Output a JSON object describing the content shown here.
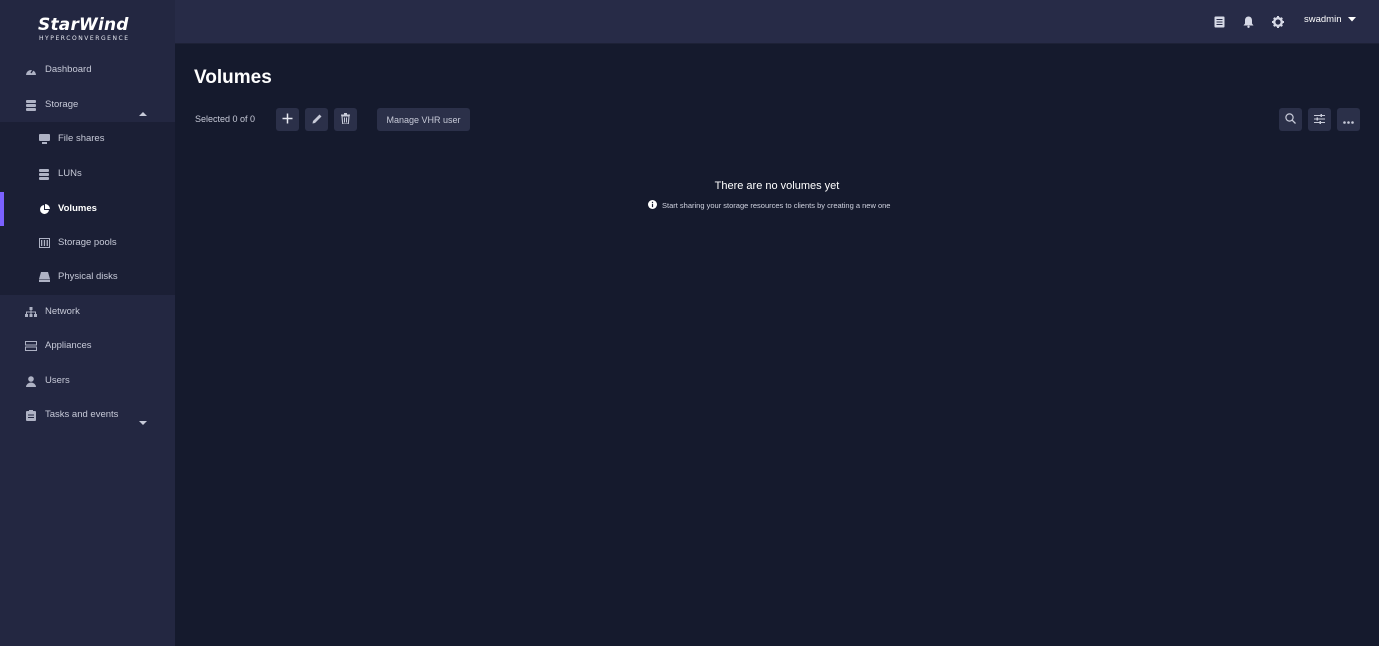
{
  "brand": {
    "name": "StarWind",
    "tagline": "HYPERCONVERGENCE"
  },
  "sidebar": {
    "items": [
      {
        "label": "Dashboard",
        "icon": "dashboard-icon"
      },
      {
        "label": "Storage",
        "icon": "storage-icon",
        "expanded": true
      },
      {
        "label": "File shares",
        "icon": "file-shares-icon"
      },
      {
        "label": "LUNs",
        "icon": "luns-icon"
      },
      {
        "label": "Volumes",
        "icon": "volumes-icon",
        "active": true
      },
      {
        "label": "Storage pools",
        "icon": "storage-pools-icon"
      },
      {
        "label": "Physical disks",
        "icon": "physical-disks-icon"
      },
      {
        "label": "Network",
        "icon": "network-icon"
      },
      {
        "label": "Appliances",
        "icon": "appliances-icon"
      },
      {
        "label": "Users",
        "icon": "users-icon"
      },
      {
        "label": "Tasks and events",
        "icon": "tasks-icon",
        "expanded": false
      }
    ]
  },
  "header": {
    "icons": [
      "log-icon",
      "bell-icon",
      "gear-icon"
    ],
    "user": "swadmin"
  },
  "main": {
    "title": "Volumes",
    "selection": "Selected 0 of 0",
    "toolbar": {
      "add": "add-icon",
      "edit": "edit-icon",
      "delete": "delete-icon",
      "manage_label": "Manage VHR user",
      "right_icons": [
        "search-icon",
        "filter-icon",
        "more-icon"
      ]
    },
    "empty": {
      "title": "There are no volumes yet",
      "hint": "Start sharing your storage resources to clients by creating a new one"
    }
  },
  "colors": {
    "accent": "#7b61ff",
    "sidebar": "#232741",
    "background": "#151a2d"
  }
}
